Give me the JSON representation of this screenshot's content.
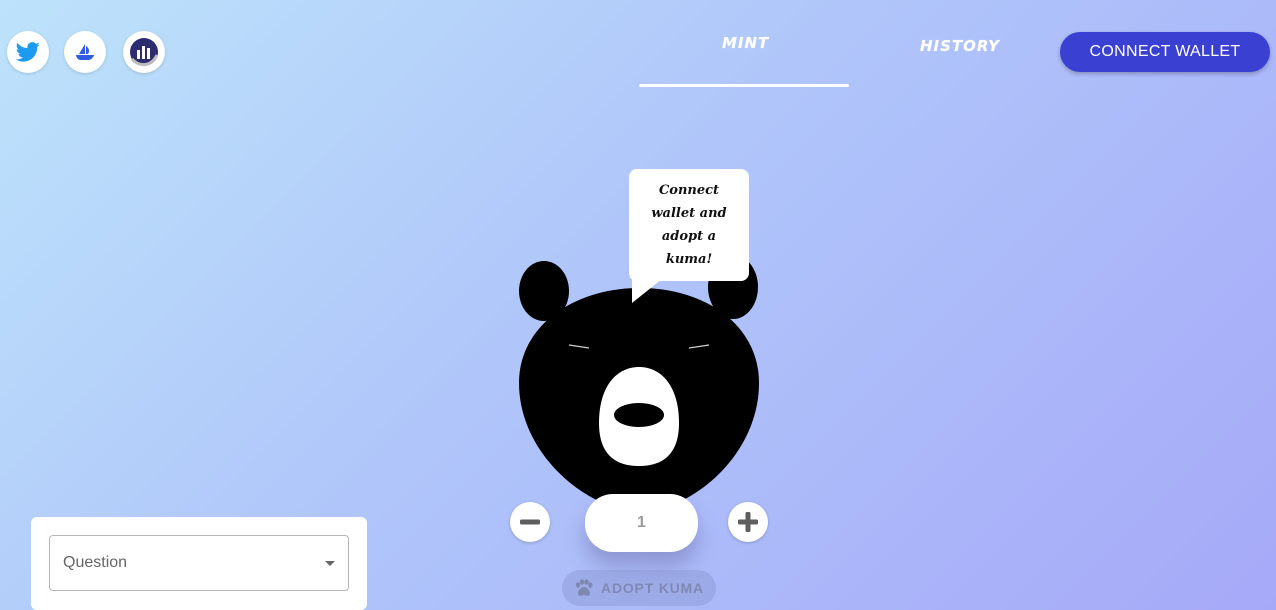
{
  "nav": {
    "mint_label": "MINT",
    "history_label": "HISTORY",
    "connect_wallet_label": "CONNECT WALLET"
  },
  "social_icons": [
    "twitter-icon",
    "opensea-icon",
    "analytics-icon"
  ],
  "speech_bubble": {
    "text": "Connect wallet and adopt a kuma!"
  },
  "mint": {
    "quantity": "1",
    "adopt_label": "ADOPT KUMA"
  },
  "question": {
    "label": "Question"
  },
  "colors": {
    "accent": "#3a41d2",
    "twitter": "#1d9bf0",
    "opensea": "#2081e2",
    "analytics": "#2c2c6e"
  }
}
